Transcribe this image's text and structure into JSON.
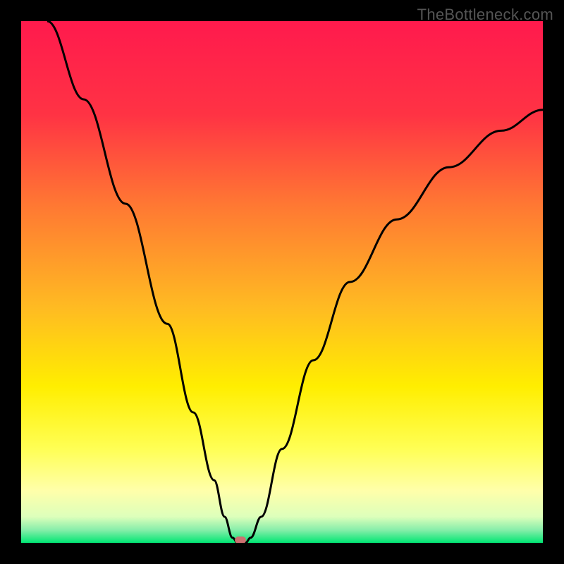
{
  "watermark": "TheBottleneck.com",
  "chart_data": {
    "type": "line",
    "title": "",
    "xlabel": "",
    "ylabel": "",
    "xlim": [
      0,
      100
    ],
    "ylim": [
      0,
      100
    ],
    "gradient_colors": {
      "top": "#ff1a4d",
      "mid_upper": "#ff6633",
      "mid": "#ffcc00",
      "mid_lower": "#ffff66",
      "lower": "#ffffcc",
      "bottom": "#00e673"
    },
    "curve_points": [
      {
        "x": 5,
        "y": 100
      },
      {
        "x": 12,
        "y": 85
      },
      {
        "x": 20,
        "y": 65
      },
      {
        "x": 28,
        "y": 42
      },
      {
        "x": 33,
        "y": 25
      },
      {
        "x": 37,
        "y": 12
      },
      {
        "x": 39,
        "y": 5
      },
      {
        "x": 40.5,
        "y": 1
      },
      {
        "x": 41.5,
        "y": 0
      },
      {
        "x": 43,
        "y": 0
      },
      {
        "x": 44,
        "y": 1
      },
      {
        "x": 46,
        "y": 5
      },
      {
        "x": 50,
        "y": 18
      },
      {
        "x": 56,
        "y": 35
      },
      {
        "x": 63,
        "y": 50
      },
      {
        "x": 72,
        "y": 62
      },
      {
        "x": 82,
        "y": 72
      },
      {
        "x": 92,
        "y": 79
      },
      {
        "x": 100,
        "y": 83
      }
    ],
    "marker": {
      "x": 42,
      "y": 0.5
    }
  }
}
